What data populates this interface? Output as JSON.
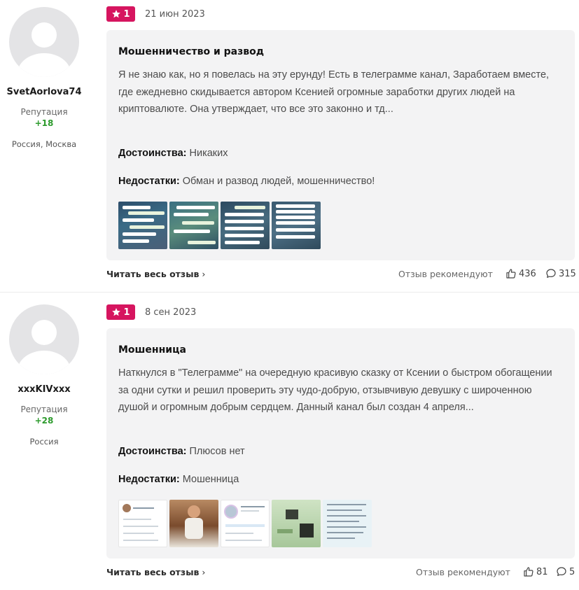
{
  "reviews": [
    {
      "author": {
        "username": "SvetAorlova74",
        "reputation_label": "Репутация",
        "reputation_value": "+18",
        "location": "Россия, Москва"
      },
      "rating": "1",
      "date": "21 июн 2023",
      "title": "Мошенничество и развод",
      "text": "Я не знаю как, но я повелась на эту ерунду! Есть в телеграмме канал, Заработаем вместе, где ежедневно скидывается автором Ксенией огромные заработки других людей на криптовалюте. Она утверждает, что все это законно и тд...",
      "pros_label": "Достоинства:",
      "pros": "Никаких",
      "cons_label": "Недостатки:",
      "cons": "Обман и развод людей, мошенничество!",
      "read_more": "Читать весь отзыв",
      "recommend_label": "Отзыв рекомендуют",
      "likes": "436",
      "comments": "315"
    },
    {
      "author": {
        "username": "xxxKIVxxx",
        "reputation_label": "Репутация",
        "reputation_value": "+28",
        "location": "Россия"
      },
      "rating": "1",
      "date": "8 сен 2023",
      "title": "Мошенница",
      "text": "Наткнулся в \"Телеграмме\" на очередную красивую сказку от Ксении о быстром обогащении за одни сутки и решил проверить эту чудо-добрую, отзывчивую девушку с широченною душой и огромным добрым сердцем. Данный канал был создан 4 апреля...",
      "pros_label": "Достоинства:",
      "pros": "Плюсов нет",
      "cons_label": "Недостатки:",
      "cons": "Мошенница",
      "read_more": "Читать весь отзыв",
      "recommend_label": "Отзыв рекомендуют",
      "likes": "81",
      "comments": "5"
    }
  ],
  "colors": {
    "badge": "#d6155f",
    "reputation": "#2d9b2d",
    "card_bg": "#f3f3f4"
  },
  "icons": {
    "rating": "star-icon",
    "likes": "thumbs-up-icon",
    "comments": "comment-icon",
    "read_more": "chevron-right-icon"
  }
}
